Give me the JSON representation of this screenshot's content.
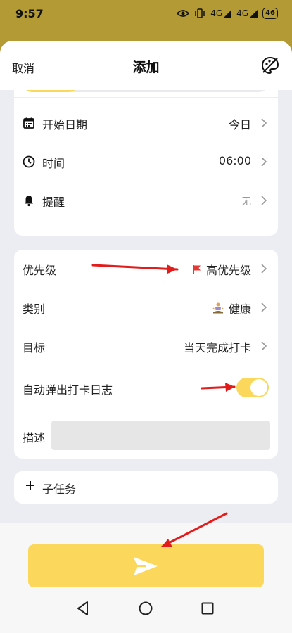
{
  "status_bar": {
    "time": "9:57",
    "signal1": "4G",
    "signal2": "4G",
    "battery": "46"
  },
  "header": {
    "cancel_label": "取消",
    "title": "添加"
  },
  "date_card": {
    "start_date": {
      "label": "开始日期",
      "value": "今日"
    },
    "time": {
      "label": "时间",
      "value": "06:00"
    },
    "reminder": {
      "label": "提醒",
      "value": "无"
    }
  },
  "details_card": {
    "priority": {
      "label": "优先级",
      "value": "高优先级"
    },
    "category": {
      "label": "类别",
      "value": "健康"
    },
    "goal": {
      "label": "目标",
      "value": "当天完成打卡"
    },
    "auto_log": {
      "label": "自动弹出打卡日志",
      "enabled": true
    },
    "description": {
      "label": "描述",
      "value": ""
    }
  },
  "subtask": {
    "label": "子任务"
  },
  "colors": {
    "accent": "#fbd85c",
    "background": "#ecedf2",
    "status": "#b39a35",
    "flag": "#e53935",
    "arrow": "#e21b1b"
  }
}
